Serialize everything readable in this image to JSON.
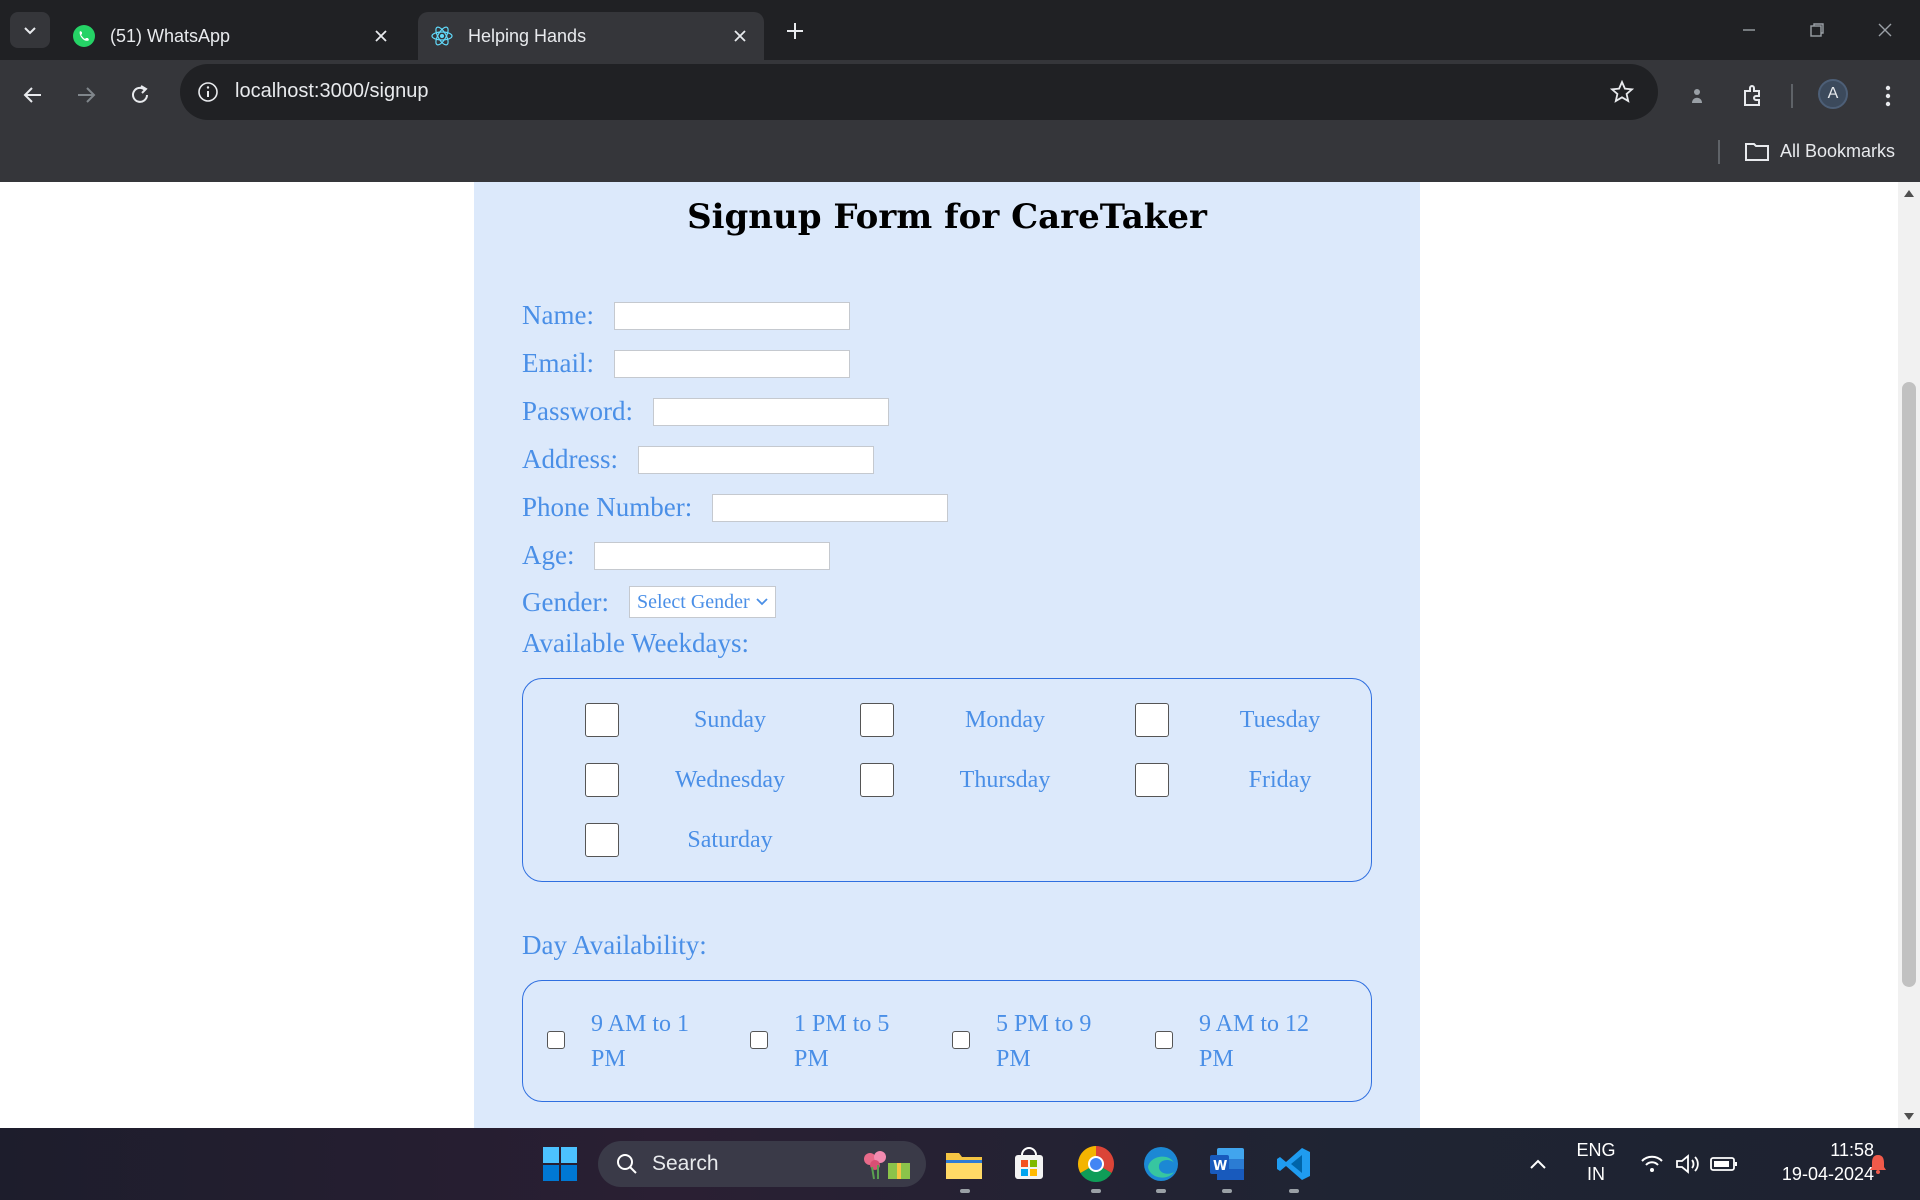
{
  "browser": {
    "tabs": [
      {
        "title": "(51) WhatsApp",
        "active": false
      },
      {
        "title": "Helping Hands",
        "active": true
      }
    ],
    "url": "localhost:3000/signup",
    "profile_initial": "A",
    "bookmarks_label": "All Bookmarks"
  },
  "form": {
    "title": "Signup Form for CareTaker",
    "fields": {
      "name": {
        "label": "Name:",
        "value": ""
      },
      "email": {
        "label": "Email:",
        "value": ""
      },
      "password": {
        "label": "Password:",
        "value": ""
      },
      "address": {
        "label": "Address:",
        "value": ""
      },
      "phone": {
        "label": "Phone Number:",
        "value": ""
      },
      "age": {
        "label": "Age:",
        "value": ""
      }
    },
    "gender": {
      "label": "Gender:",
      "selected": "Select Gender"
    },
    "weekdays_label": "Available Weekdays:",
    "weekdays": [
      "Sunday",
      "Monday",
      "Tuesday",
      "Wednesday",
      "Thursday",
      "Friday",
      "Saturday"
    ],
    "day_availability_label": "Day Availability:",
    "time_slots": [
      "9 AM to 1 PM",
      "1 PM to 5 PM",
      "5 PM to 9 PM",
      "9 AM to 12 PM"
    ]
  },
  "taskbar": {
    "search_placeholder": "Search",
    "language": "ENG",
    "region": "IN",
    "time": "11:58",
    "date": "19-04-2024"
  },
  "colors": {
    "form_background": "#dce9fb",
    "label_blue": "#4a8fe7",
    "box_border": "#2f6fe0"
  }
}
